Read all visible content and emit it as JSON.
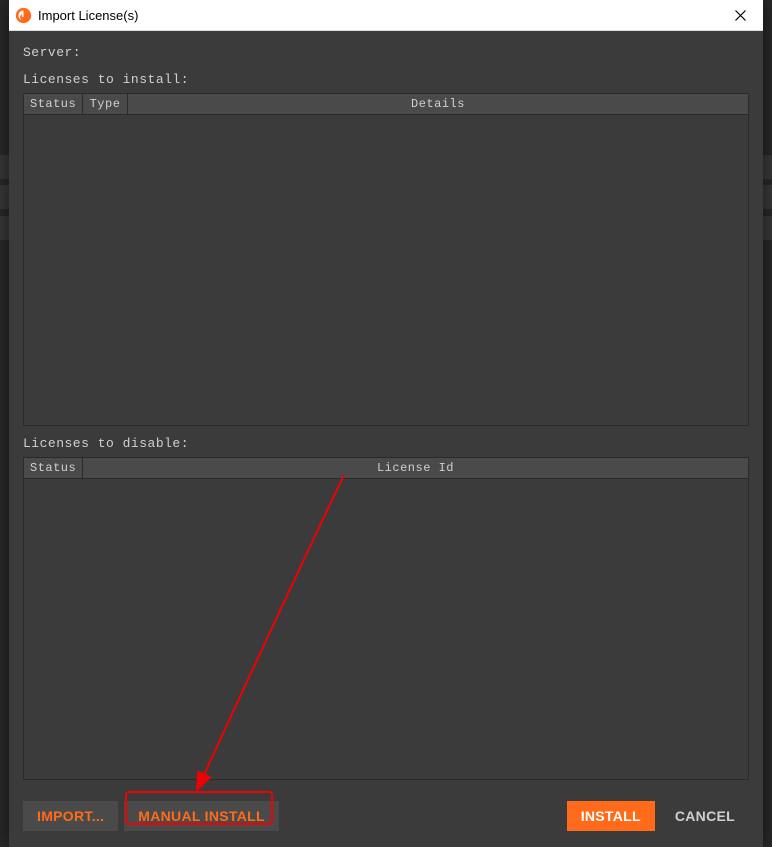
{
  "window": {
    "title": "Import License(s)"
  },
  "labels": {
    "server": "Server:",
    "licenses_to_install": "Licenses to install:",
    "licenses_to_disable": "Licenses to disable:"
  },
  "install_table": {
    "columns": {
      "status": "Status",
      "type": "Type",
      "details": "Details"
    },
    "rows": []
  },
  "disable_table": {
    "columns": {
      "status": "Status",
      "license_id": "License Id"
    },
    "rows": []
  },
  "buttons": {
    "import": "IMPORT...",
    "manual_install": "MANUAL INSTALL",
    "install": "INSTALL",
    "cancel": "CANCEL"
  },
  "highlight": {
    "target": "manual-install-button",
    "color": "#f00000"
  }
}
